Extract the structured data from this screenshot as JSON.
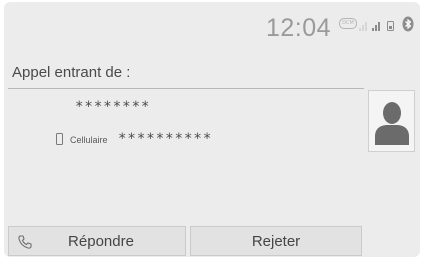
{
  "status_bar": {
    "time": "12:04",
    "data_badge": "DCM",
    "icons": [
      "dcm-badge-icon",
      "signal-faint-icon",
      "signal-icon",
      "phone-battery-icon",
      "bluetooth-icon"
    ]
  },
  "call": {
    "title": "Appel entrant de :",
    "caller_name": "********",
    "number_type": "Cellulaire",
    "number": "**********",
    "icons": [
      "mobile-phone-icon",
      "contact-avatar-icon"
    ]
  },
  "actions": {
    "answer_label": "Répondre",
    "reject_label": "Rejeter",
    "answer_icon": "phone-handset-icon"
  }
}
